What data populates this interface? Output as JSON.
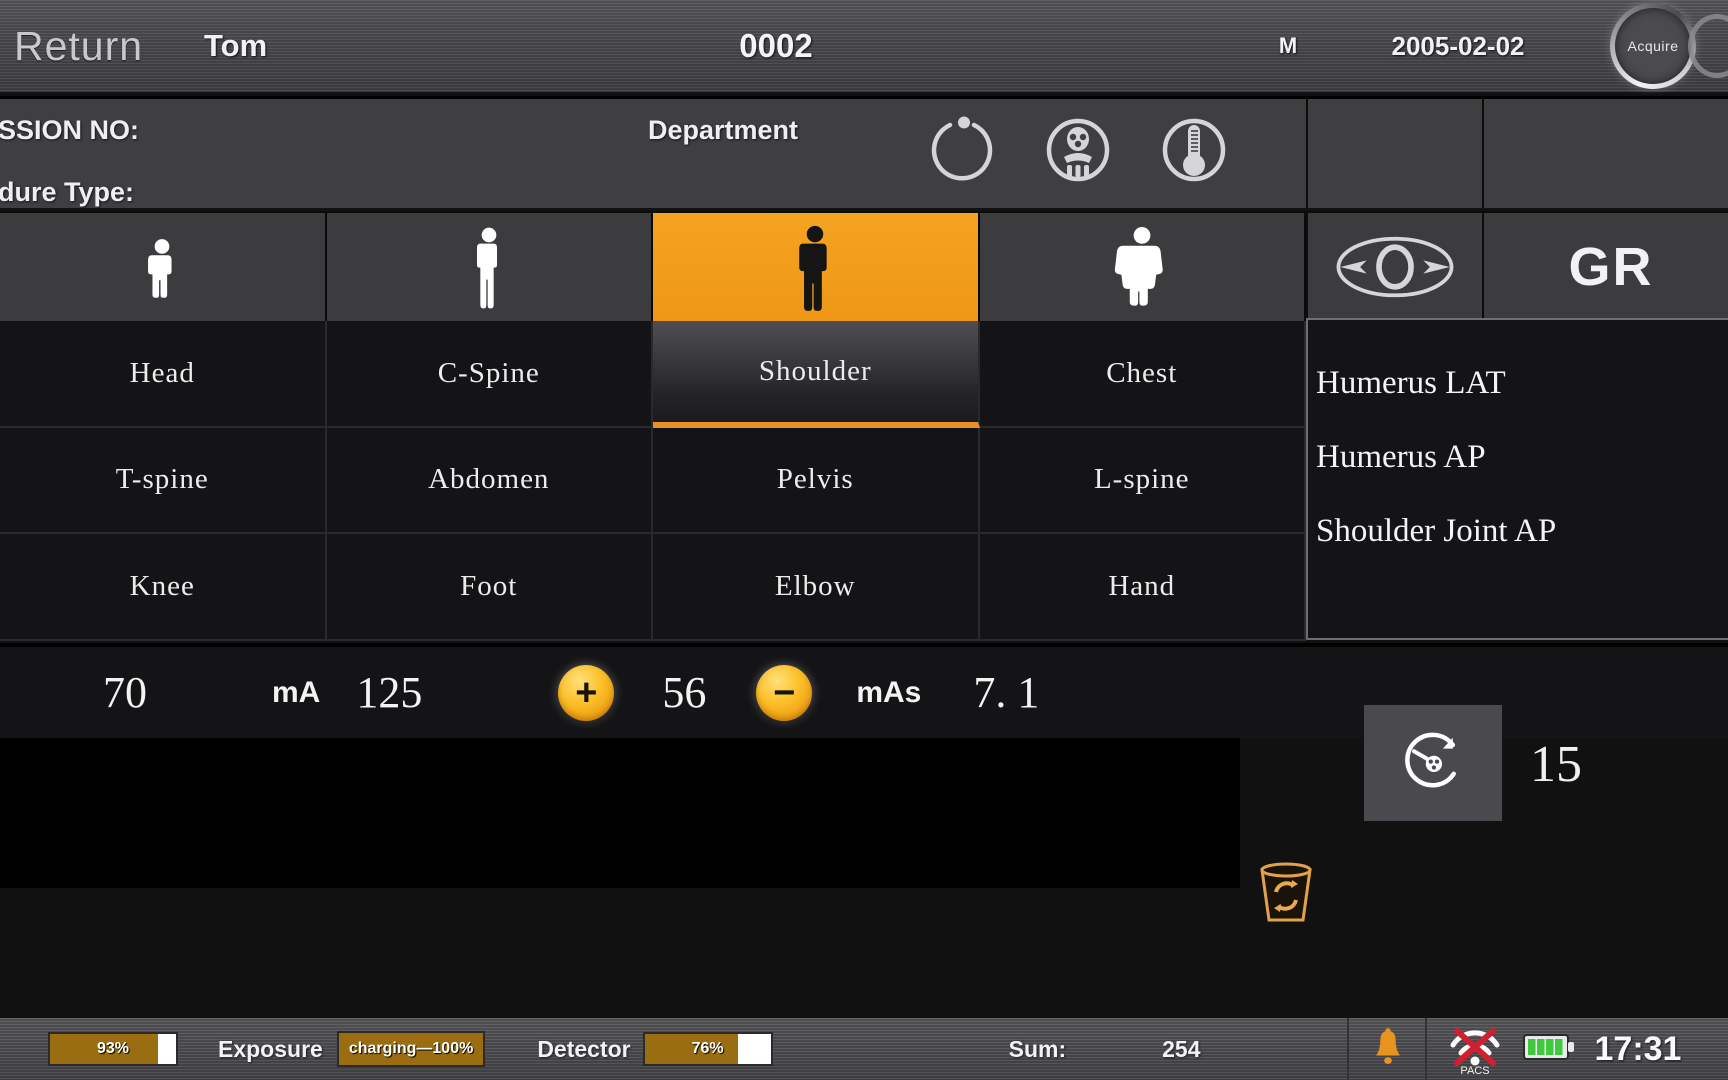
{
  "topbar": {
    "return_label": "Return",
    "patient_name": "Tom",
    "patient_id": "0002",
    "patient_sex": "M",
    "patient_dob": "2005-02-02",
    "acquire_label": "Acquire"
  },
  "infobar": {
    "admission_label": "SSION NO:",
    "procedure_label": "dure Type:",
    "department_label": "Department",
    "icons": [
      "power-standby-icon",
      "radiation-person-icon",
      "thermometer-icon"
    ]
  },
  "body_sizes": [
    {
      "name": "child",
      "selected": false
    },
    {
      "name": "thin-adult",
      "selected": false
    },
    {
      "name": "normal-adult",
      "selected": true
    },
    {
      "name": "large-adult",
      "selected": false
    }
  ],
  "right_panel": {
    "collimator_icon": "collimator-icon",
    "grid_label": "GR"
  },
  "body_parts": [
    {
      "label": "Head",
      "selected": false
    },
    {
      "label": "C-Spine",
      "selected": false
    },
    {
      "label": "Shoulder",
      "selected": true
    },
    {
      "label": "Chest",
      "selected": false
    },
    {
      "label": "T-spine",
      "selected": false
    },
    {
      "label": "Abdomen",
      "selected": false
    },
    {
      "label": "Pelvis",
      "selected": false
    },
    {
      "label": "L-spine",
      "selected": false
    },
    {
      "label": "Knee",
      "selected": false
    },
    {
      "label": "Foot",
      "selected": false
    },
    {
      "label": "Elbow",
      "selected": false
    },
    {
      "label": "Hand",
      "selected": false
    }
  ],
  "dropdown": {
    "items": [
      {
        "label": "Humerus LAT",
        "hovered": false
      },
      {
        "label": "Humerus AP",
        "hovered": true
      },
      {
        "label": "Shoulder Joint AP",
        "hovered": false
      }
    ]
  },
  "parameters": {
    "kv_value": "70",
    "ma_label": "mA",
    "ma_value": "125",
    "plus_label": "+",
    "ms_value": "56",
    "minus_label": "−",
    "mas_label": "mAs",
    "mas_value": "7. 1",
    "rotate_icon": "radiation-timer-icon",
    "counter_value": "15"
  },
  "tools": {
    "trash_icon": "recycle-bin-icon"
  },
  "statusbar": {
    "battery_percent": "93%",
    "battery_fill": 86,
    "exposure_label": "Exposure",
    "exposure_status": "charging—100%",
    "detector_label": "Detector",
    "detector_percent": "76%",
    "detector_fill": 74,
    "sum_label": "Sum:",
    "sum_value": "254",
    "bell_icon": "bell-icon",
    "pacs_icon": "pacs-disconnected-icon",
    "pacs_label": "PACS",
    "battery_icon": "battery-full-icon",
    "time": "17:31"
  },
  "colors": {
    "accent_orange": "#ef9716",
    "panel_dark": "#141416",
    "header_gray": "#4d4d51",
    "status_amber": "#9a6d10",
    "battery_green": "#3ec93e",
    "pacs_red": "#cf2030"
  }
}
